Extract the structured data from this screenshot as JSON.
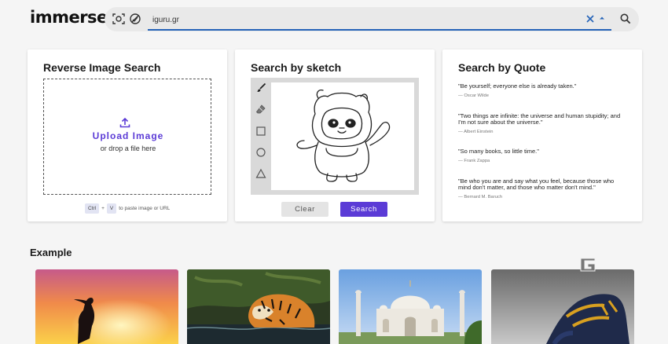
{
  "header": {
    "logo": "immerse",
    "search_value": "iguru.gr",
    "icons": [
      "camera-scan-icon",
      "no-filter-icon",
      "clear-icon",
      "dropdown-icon",
      "search-icon"
    ]
  },
  "reverse": {
    "title": "Reverse Image Search",
    "upload_label": "Upload Image",
    "drop_hint": "or drop a file here",
    "kbd_ctrl": "Ctrl",
    "kbd_plus": "+",
    "kbd_v": "V",
    "paste_hint": "to paste image or URL"
  },
  "sketch": {
    "title": "Search by sketch",
    "tools": [
      "brush-icon",
      "eraser-icon",
      "square-icon",
      "circle-icon",
      "triangle-icon"
    ],
    "clear_label": "Clear",
    "search_label": "Search"
  },
  "quotes": {
    "title": "Search by Quote",
    "items": [
      {
        "text": "\"Be yourself; everyone else is already taken.\"",
        "author": "— Oscar Wilde"
      },
      {
        "text": "\"Two things are infinite: the universe and human stupidity; and I'm not sure about the universe.\"",
        "author": "— Albert Einstein"
      },
      {
        "text": "\"So many books, so little time.\"",
        "author": "— Frank Zappa"
      },
      {
        "text": "\"Be who you are and say what you feel, because those who mind don't matter, and those who matter don't mind.\"",
        "author": "— Bernard M. Baruch"
      }
    ]
  },
  "example": {
    "title": "Example",
    "images": [
      "sunset-silhouette",
      "tiger-in-water",
      "taj-mahal",
      "sneaker"
    ]
  },
  "colors": {
    "accent": "#5b3bd6",
    "input_underline": "#2563b8"
  }
}
